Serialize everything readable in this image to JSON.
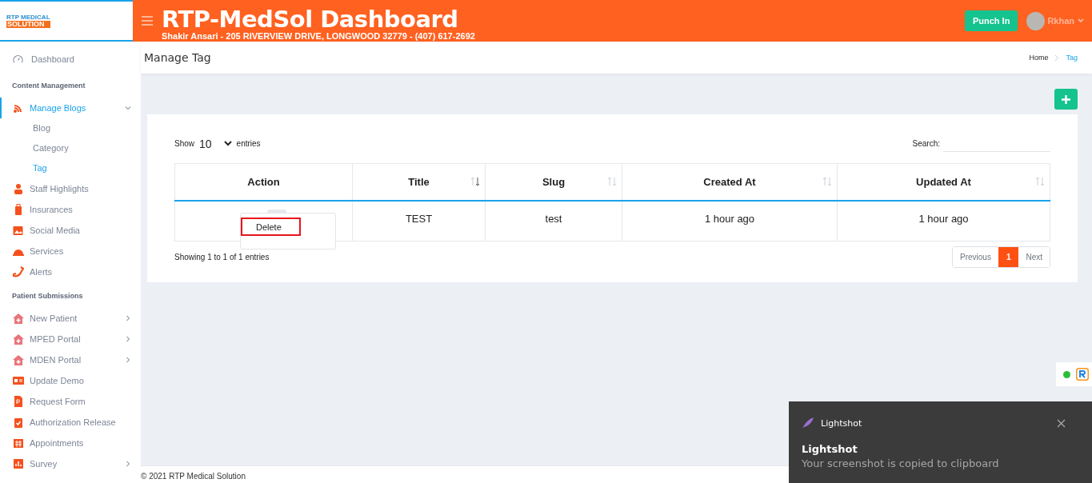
{
  "logo": {
    "top": "RTP MEDICAL",
    "bottom": "SOLUTION"
  },
  "header": {
    "title": "RTP-MedSol Dashboard",
    "subtitle": "Shakir Ansari - 205 RIVERVIEW DRIVE, LONGWOOD 32779 - (407) 617-2692",
    "punch_button": "Punch In",
    "user": "Rkhan"
  },
  "sidebar": {
    "top_item": {
      "label": "Dashboard",
      "selected": false
    },
    "sections": [
      {
        "title": "Content Management",
        "items": [
          {
            "label": "Manage Blogs",
            "kind": "submenu",
            "expanded": true,
            "selected": true,
            "children": [
              {
                "label": "Blog",
                "selected": false
              },
              {
                "label": "Category",
                "selected": false
              },
              {
                "label": "Tag",
                "selected": true
              }
            ]
          },
          {
            "label": "Staff Highlights",
            "kind": "link",
            "selected": false
          },
          {
            "label": "Insurances",
            "kind": "link",
            "selected": false
          },
          {
            "label": "Social Media",
            "kind": "link",
            "selected": false
          },
          {
            "label": "Services",
            "kind": "link",
            "selected": false
          },
          {
            "label": "Alerts",
            "kind": "link",
            "selected": false
          }
        ]
      },
      {
        "title": "Patient Submissions",
        "items": [
          {
            "label": "New Patient",
            "kind": "submenu",
            "expanded": false,
            "selected": false
          },
          {
            "label": "MPED Portal",
            "kind": "submenu",
            "expanded": false,
            "selected": false
          },
          {
            "label": "MDEN Portal",
            "kind": "submenu",
            "expanded": false,
            "selected": false
          },
          {
            "label": "Update Demo",
            "kind": "link",
            "selected": false
          },
          {
            "label": "Request Form",
            "kind": "link",
            "selected": false
          },
          {
            "label": "Authorization Release",
            "kind": "link",
            "selected": false
          },
          {
            "label": "Appointments",
            "kind": "link",
            "selected": false
          },
          {
            "label": "Survey",
            "kind": "submenu",
            "expanded": false,
            "selected": false
          }
        ]
      }
    ]
  },
  "page": {
    "title": "Manage Tag",
    "breadcrumb": [
      {
        "label": "Home",
        "selected": false
      },
      {
        "label": "Tag",
        "selected": true
      }
    ]
  },
  "table_controls": {
    "show_label": "Show",
    "page_size": "10",
    "entries_label": "entries",
    "search_label": "Search:"
  },
  "table": {
    "columns": [
      {
        "label": "Action",
        "sortable": false
      },
      {
        "label": "Title",
        "sortable": true
      },
      {
        "label": "Slug",
        "sortable": true
      },
      {
        "label": "Created At",
        "sortable": true
      },
      {
        "label": "Updated At",
        "sortable": true
      }
    ],
    "rows": [
      {
        "cells": [
          "",
          "TEST",
          "test",
          "1 hour ago",
          "1 hour ago"
        ]
      }
    ]
  },
  "action_menu": {
    "items": [
      "Delete"
    ]
  },
  "info": "Showing 1 to 1 of 1 entries",
  "pagination": [
    {
      "label": "Previous",
      "kind": "prev",
      "selected": false
    },
    {
      "label": "1",
      "kind": "page",
      "selected": true
    },
    {
      "label": "Next",
      "kind": "next",
      "selected": false
    }
  ],
  "footer": "© 2021 RTP Medical Solution",
  "toast": {
    "app": "Lightshot",
    "title": "Lightshot",
    "message": "Your screenshot is copied to clipboard"
  }
}
